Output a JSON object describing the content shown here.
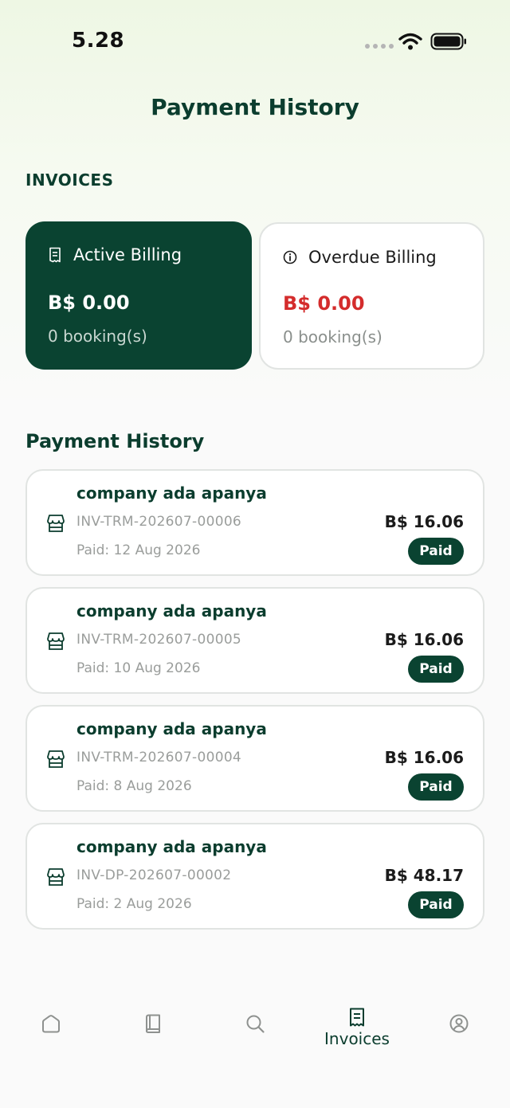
{
  "status_bar": {
    "time": "5.28"
  },
  "header": {
    "title": "Payment History"
  },
  "invoices_section": {
    "label": "INVOICES"
  },
  "billing": {
    "active": {
      "title": "Active Billing",
      "amount": "B$ 0.00",
      "count": "0 booking(s)"
    },
    "overdue": {
      "title": "Overdue Billing",
      "amount": "B$ 0.00",
      "count": "0 booking(s)"
    }
  },
  "history": {
    "title": "Payment History",
    "items": [
      {
        "company": "company ada apanya",
        "number": "INV-TRM-202607-00006",
        "paid": "Paid: 12 Aug 2026",
        "amount": "B$ 16.06",
        "status": "Paid"
      },
      {
        "company": "company ada apanya",
        "number": "INV-TRM-202607-00005",
        "paid": "Paid: 10 Aug 2026",
        "amount": "B$ 16.06",
        "status": "Paid"
      },
      {
        "company": "company ada apanya",
        "number": "INV-TRM-202607-00004",
        "paid": "Paid: 8 Aug 2026",
        "amount": "B$ 16.06",
        "status": "Paid"
      },
      {
        "company": "company ada apanya",
        "number": "INV-DP-202607-00002",
        "paid": "Paid: 2 Aug 2026",
        "amount": "B$ 48.17",
        "status": "Paid"
      }
    ]
  },
  "bottom_nav": {
    "items": [
      {
        "icon": "home-icon",
        "label": ""
      },
      {
        "icon": "book-icon",
        "label": ""
      },
      {
        "icon": "search-icon",
        "label": ""
      },
      {
        "icon": "invoice-icon",
        "label": "Invoices",
        "active": true
      },
      {
        "icon": "profile-icon",
        "label": ""
      }
    ]
  },
  "colors": {
    "primary": "#0a4331",
    "danger": "#d42c2c",
    "muted": "#9a9d9b"
  }
}
